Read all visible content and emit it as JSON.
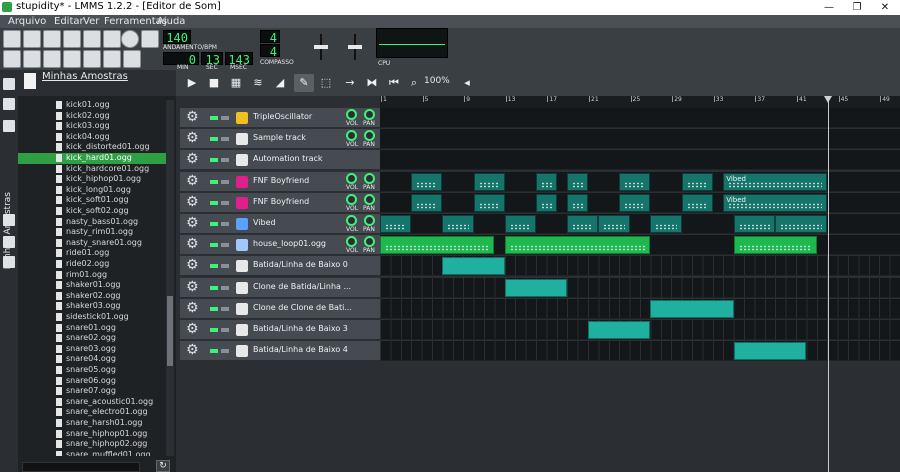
{
  "window": {
    "title": "stupidity* - LMMS 1.2.2 - [Editor de Som]",
    "min_glyph": "—",
    "max_glyph": "❐",
    "close_glyph": "✕"
  },
  "menu": [
    "Arquivo",
    "Editar",
    "Ver",
    "Ferramentas",
    "Ajuda"
  ],
  "toolbar": {
    "tempo": "140",
    "tempo_label": "ANDAMENTO/BPM",
    "time_min": "0",
    "time_sec": "13",
    "time_msec": "143",
    "min_label": "MIN",
    "sec_label": "SEC",
    "msec_label": "MSEC",
    "sig_num": "4",
    "sig_den": "4",
    "sig_label": "COMPASSO",
    "cpu_label": "CPU"
  },
  "sidebar": {
    "tab_label": "Minhas Amostras",
    "browser_title": "Minhas Amostras",
    "files": [
      "kick01.ogg",
      "kick02.ogg",
      "kick03.ogg",
      "kick04.ogg",
      "kick_distorted01.ogg",
      "kick_hard01.ogg",
      "kick_hardcore01.ogg",
      "kick_hiphop01.ogg",
      "kick_long01.ogg",
      "kick_soft01.ogg",
      "kick_soft02.ogg",
      "nasty_bass01.ogg",
      "nasty_rim01.ogg",
      "nasty_snare01.ogg",
      "ride01.ogg",
      "ride02.ogg",
      "rim01.ogg",
      "shaker01.ogg",
      "shaker02.ogg",
      "shaker03.ogg",
      "sidestick01.ogg",
      "snare01.ogg",
      "snare02.ogg",
      "snare03.ogg",
      "snare04.ogg",
      "snare05.ogg",
      "snare06.ogg",
      "snare07.ogg",
      "snare_acoustic01.ogg",
      "snare_electro01.ogg",
      "snare_harsh01.ogg",
      "snare_hiphop01.ogg",
      "snare_hiphop02.ogg",
      "snare_muffled01.ogg"
    ],
    "selected_index": 5,
    "refresh_glyph": "↻"
  },
  "editor": {
    "zoom": "100%",
    "bar_labels": [
      "1",
      "5",
      "9",
      "13",
      "17",
      "21",
      "25",
      "29",
      "33",
      "37",
      "41",
      "45",
      "49"
    ],
    "vol_label": "VOL",
    "pan_label": "PAN",
    "tracks": [
      {
        "name": "TripleOscillator",
        "icon": "triple-oscillator-icon",
        "color": "#f0c020",
        "knobs": true,
        "lane": "dark",
        "clips": []
      },
      {
        "name": "Sample track",
        "icon": "waveform-icon",
        "color": "#e8e8e8",
        "knobs": true,
        "lane": "dark",
        "clips": []
      },
      {
        "name": "Automation track",
        "icon": "automation-icon",
        "color": "#e8e8e8",
        "knobs": false,
        "lane": "dark",
        "clips": []
      },
      {
        "name": "FNF Boyfriend",
        "icon": "synth-keyboard-icon",
        "color": "#e0208a",
        "knobs": true,
        "lane": "dark",
        "clips": [
          {
            "start": 3,
            "len": 3,
            "style": "teal",
            "label": ""
          },
          {
            "start": 9,
            "len": 3,
            "style": "teal",
            "label": ""
          },
          {
            "start": 15,
            "len": 2,
            "style": "teal",
            "label": ""
          },
          {
            "start": 18,
            "len": 2,
            "style": "teal",
            "label": ""
          },
          {
            "start": 23,
            "len": 3,
            "style": "teal",
            "label": ""
          },
          {
            "start": 29,
            "len": 3,
            "style": "teal",
            "label": ""
          },
          {
            "start": 33,
            "len": 10,
            "style": "teal",
            "label": "Vibed"
          }
        ]
      },
      {
        "name": "FNF Boyfriend",
        "icon": "synth-keyboard-icon",
        "color": "#e0208a",
        "knobs": true,
        "lane": "dark",
        "clips": [
          {
            "start": 3,
            "len": 3,
            "style": "teal",
            "label": ""
          },
          {
            "start": 9,
            "len": 3,
            "style": "teal",
            "label": ""
          },
          {
            "start": 15,
            "len": 2,
            "style": "teal",
            "label": ""
          },
          {
            "start": 18,
            "len": 2,
            "style": "teal",
            "label": ""
          },
          {
            "start": 23,
            "len": 3,
            "style": "teal",
            "label": ""
          },
          {
            "start": 29,
            "len": 3,
            "style": "teal",
            "label": ""
          },
          {
            "start": 33,
            "len": 10,
            "style": "teal",
            "label": "Vibed"
          }
        ]
      },
      {
        "name": "Vibed",
        "icon": "vibed-icon",
        "color": "#5aa0ff",
        "knobs": true,
        "lane": "dark",
        "clips": [
          {
            "start": 0,
            "len": 3,
            "style": "teal",
            "label": ""
          },
          {
            "start": 6,
            "len": 3,
            "style": "teal",
            "label": ""
          },
          {
            "start": 12,
            "len": 3,
            "style": "teal",
            "label": ""
          },
          {
            "start": 18,
            "len": 3,
            "style": "teal",
            "label": ""
          },
          {
            "start": 21,
            "len": 3,
            "style": "teal",
            "label": ""
          },
          {
            "start": 26,
            "len": 3,
            "style": "teal",
            "label": ""
          },
          {
            "start": 34,
            "len": 4,
            "style": "teal",
            "label": ""
          },
          {
            "start": 38,
            "len": 5,
            "style": "teal",
            "label": ""
          }
        ]
      },
      {
        "name": "house_loop01.ogg",
        "icon": "note-icon",
        "color": "#a0c8ff",
        "knobs": true,
        "lane": "dark",
        "clips": [
          {
            "start": 0,
            "len": 11,
            "style": "green",
            "label": ""
          },
          {
            "start": 12,
            "len": 14,
            "style": "green",
            "label": ""
          },
          {
            "start": 34,
            "len": 8,
            "style": "green",
            "label": ""
          }
        ]
      },
      {
        "name": "Batida/Linha de Baixo 0",
        "icon": "beat-grid-icon",
        "color": "#e8e8e8",
        "knobs": false,
        "lane": "grid",
        "clips": [
          {
            "start": 6,
            "len": 6,
            "style": "bright",
            "label": ""
          }
        ]
      },
      {
        "name": "Clone de Batida/Linha ...",
        "icon": "beat-grid-icon",
        "color": "#e8e8e8",
        "knobs": false,
        "lane": "grid",
        "clips": [
          {
            "start": 12,
            "len": 6,
            "style": "bright",
            "label": ""
          }
        ]
      },
      {
        "name": "Clone de Clone de Bati...",
        "icon": "beat-grid-icon",
        "color": "#e8e8e8",
        "knobs": false,
        "lane": "grid",
        "clips": [
          {
            "start": 26,
            "len": 8,
            "style": "bright",
            "label": ""
          }
        ]
      },
      {
        "name": "Batida/Linha de Baixo 3",
        "icon": "beat-grid-icon",
        "color": "#e8e8e8",
        "knobs": false,
        "lane": "grid",
        "clips": [
          {
            "start": 20,
            "len": 6,
            "style": "bright",
            "label": ""
          }
        ]
      },
      {
        "name": "Batida/Linha de Baixo 4",
        "icon": "beat-grid-icon",
        "color": "#e8e8e8",
        "knobs": false,
        "lane": "grid",
        "clips": [
          {
            "start": 34,
            "len": 7,
            "style": "bright",
            "label": ""
          }
        ]
      }
    ]
  }
}
